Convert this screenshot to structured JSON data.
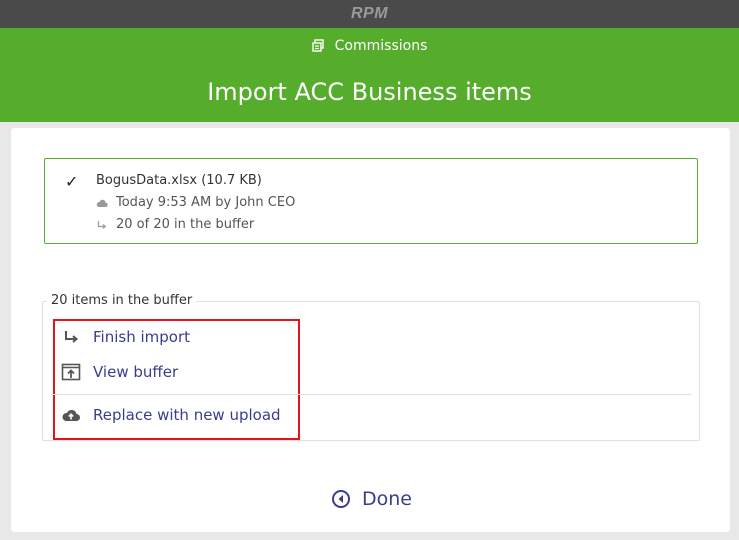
{
  "window": {
    "app_title": "RPM"
  },
  "header": {
    "breadcrumb": "Commissions",
    "title": "Import ACC Business items",
    "color": "#56ad2c"
  },
  "file": {
    "status_icon": "checkmark-icon",
    "name": "BogusData.xlsx (10.7 KB)",
    "uploaded": "Today 9:53 AM by John CEO",
    "buffer_status": "20 of 20 in the buffer"
  },
  "buffer": {
    "legend": "20 items in the buffer",
    "actions": [
      {
        "label": "Finish import",
        "icon": "arrow-return-icon"
      },
      {
        "label": "View buffer",
        "icon": "view-buffer-icon"
      },
      {
        "label": "Replace with new upload",
        "icon": "cloud-upload-icon"
      }
    ],
    "highlight_color": "#e2151b"
  },
  "footer": {
    "done_label": "Done",
    "link_color": "#3a3d8f"
  }
}
